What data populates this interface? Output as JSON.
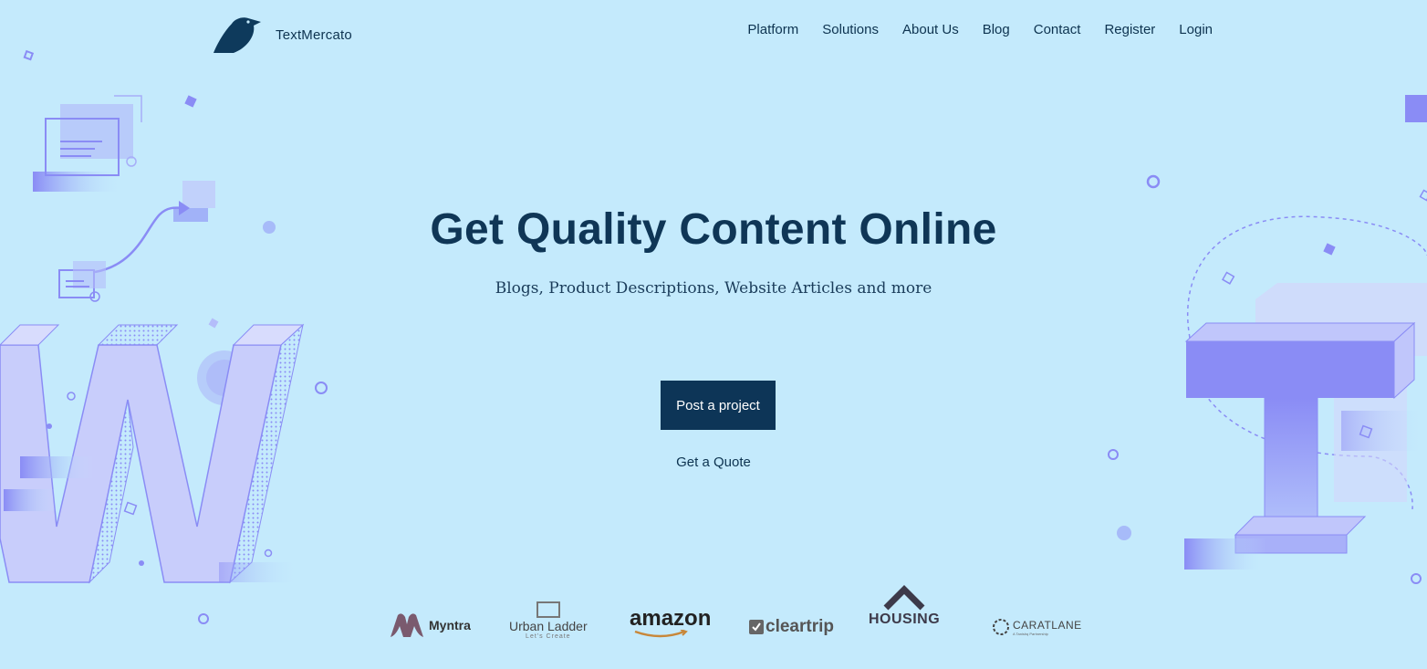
{
  "header": {
    "brand": "TextMercato",
    "nav": [
      "Platform",
      "Solutions",
      "About Us",
      "Blog",
      "Contact",
      "Register",
      "Login"
    ]
  },
  "hero": {
    "title": "Get Quality Content Online",
    "subtitle": "Blogs, Product Descriptions, Website Articles and more",
    "cta_label": "Post a project",
    "secondary_link": "Get a Quote"
  },
  "clients": {
    "myntra": "Myntra",
    "urban_ladder": "Urban Ladder",
    "urban_ladder_tagline": "Let's Create",
    "amazon": "amazon",
    "cleartrip": "cleartrip",
    "housing": "HOUSING",
    "caratlane": "CARATLANE",
    "caratlane_tagline": "A Tanishq Partnership"
  },
  "colors": {
    "background": "#c4eafc",
    "primary": "#0d3557",
    "illustration": "#8a8cf5"
  },
  "icons": [
    "bird-logo-icon"
  ]
}
